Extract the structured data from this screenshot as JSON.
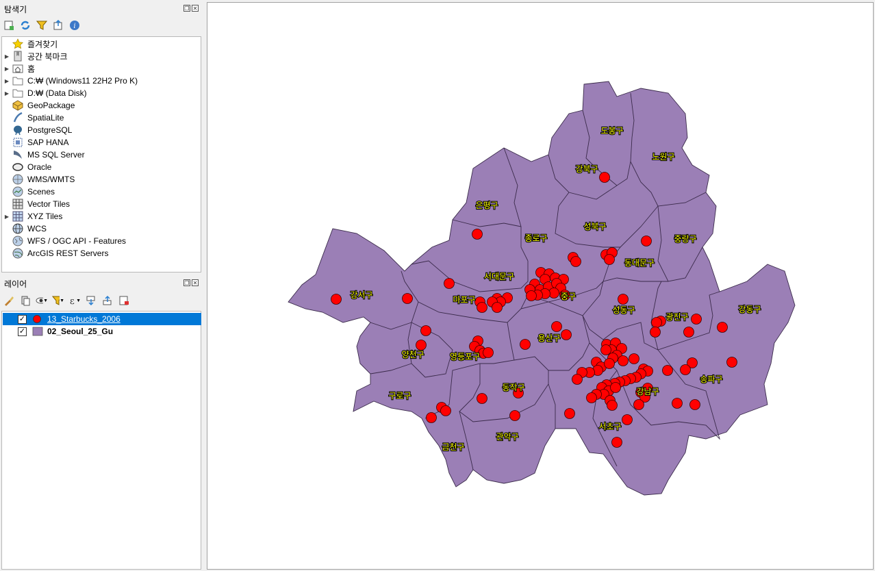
{
  "browser_panel": {
    "title": "탐색기",
    "items": [
      {
        "label": "즐겨찾기",
        "icon": "star-icon",
        "expandable": false
      },
      {
        "label": "공간 북마크",
        "icon": "bookmark-icon",
        "expandable": true
      },
      {
        "label": "홈",
        "icon": "home-folder-icon",
        "expandable": true
      },
      {
        "label": "C:₩ (Windows11 22H2 Pro K)",
        "icon": "folder-icon",
        "expandable": true
      },
      {
        "label": "D:₩ (Data Disk)",
        "icon": "folder-icon",
        "expandable": true
      },
      {
        "label": "GeoPackage",
        "icon": "geopackage-icon",
        "expandable": false
      },
      {
        "label": "SpatiaLite",
        "icon": "spatialite-icon",
        "expandable": false
      },
      {
        "label": "PostgreSQL",
        "icon": "postgresql-icon",
        "expandable": false
      },
      {
        "label": "SAP HANA",
        "icon": "sap-hana-icon",
        "expandable": false
      },
      {
        "label": "MS SQL Server",
        "icon": "mssql-icon",
        "expandable": false
      },
      {
        "label": "Oracle",
        "icon": "oracle-icon",
        "expandable": false
      },
      {
        "label": "WMS/WMTS",
        "icon": "wms-globe-icon",
        "expandable": false
      },
      {
        "label": "Scenes",
        "icon": "scenes-icon",
        "expandable": false
      },
      {
        "label": "Vector Tiles",
        "icon": "vector-tiles-icon",
        "expandable": false
      },
      {
        "label": "XYZ Tiles",
        "icon": "xyz-tiles-icon",
        "expandable": true
      },
      {
        "label": "WCS",
        "icon": "wcs-globe-icon",
        "expandable": false
      },
      {
        "label": "WFS / OGC API - Features",
        "icon": "wfs-globe-icon",
        "expandable": false
      },
      {
        "label": "ArcGIS REST Servers",
        "icon": "arcgis-globe-icon",
        "expandable": false
      }
    ]
  },
  "layers_panel": {
    "title": "레이어",
    "layers": [
      {
        "name": "13_Starbucks_2006",
        "checked": true,
        "selected": true,
        "symbol": "red-point-icon",
        "color": "#ff0000"
      },
      {
        "name": "02_Seoul_25_Gu",
        "checked": true,
        "selected": false,
        "symbol": "purple-polygon-icon",
        "color": "#9b7fb6"
      }
    ]
  },
  "map": {
    "fill_color": "#9b7fb6",
    "point_color": "#ff0000",
    "label_color": "#ffff00",
    "districts": [
      {
        "label": "도봉구"
      },
      {
        "label": "노원구"
      },
      {
        "label": "강북구"
      },
      {
        "label": "은평구"
      },
      {
        "label": "성북구"
      },
      {
        "label": "종로구"
      },
      {
        "label": "중랑구"
      },
      {
        "label": "동대문구"
      },
      {
        "label": "서대문구"
      },
      {
        "label": "강서구"
      },
      {
        "label": "마포구"
      },
      {
        "label": "중구"
      },
      {
        "label": "성동구"
      },
      {
        "label": "광진구"
      },
      {
        "label": "강동구"
      },
      {
        "label": "용산구"
      },
      {
        "label": "양천구"
      },
      {
        "label": "영등포구"
      },
      {
        "label": "동작구"
      },
      {
        "label": "송파구"
      },
      {
        "label": "구로구"
      },
      {
        "label": "강남구"
      },
      {
        "label": "서초구"
      },
      {
        "label": "관악구"
      },
      {
        "label": "금천구"
      }
    ]
  }
}
